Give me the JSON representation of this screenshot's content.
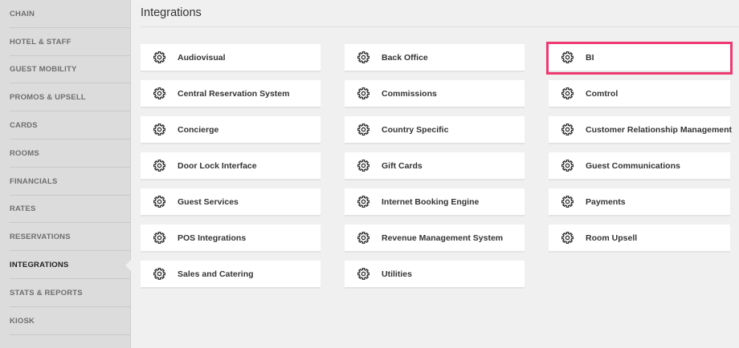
{
  "sidebar": {
    "items": [
      {
        "label": "CHAIN",
        "active": false
      },
      {
        "label": "HOTEL & STAFF",
        "active": false
      },
      {
        "label": "GUEST MOBILITY",
        "active": false
      },
      {
        "label": "PROMOS & UPSELL",
        "active": false
      },
      {
        "label": "CARDS",
        "active": false
      },
      {
        "label": "ROOMS",
        "active": false
      },
      {
        "label": "FINANCIALS",
        "active": false
      },
      {
        "label": "RATES",
        "active": false
      },
      {
        "label": "RESERVATIONS",
        "active": false
      },
      {
        "label": "INTEGRATIONS",
        "active": true
      },
      {
        "label": "STATS & REPORTS",
        "active": false
      },
      {
        "label": "KIOSK",
        "active": false
      }
    ]
  },
  "page": {
    "title": "Integrations"
  },
  "integrations": {
    "icon": "gear-icon",
    "highlight_color": "#ee3a72",
    "items": [
      {
        "label": "Audiovisual"
      },
      {
        "label": "Back Office"
      },
      {
        "label": "BI",
        "highlighted": true
      },
      {
        "label": "Central Reservation System"
      },
      {
        "label": "Commissions"
      },
      {
        "label": "Comtrol"
      },
      {
        "label": "Concierge"
      },
      {
        "label": "Country Specific"
      },
      {
        "label": "Customer Relationship Management"
      },
      {
        "label": "Door Lock Interface"
      },
      {
        "label": "Gift Cards"
      },
      {
        "label": "Guest Communications"
      },
      {
        "label": "Guest Services"
      },
      {
        "label": "Internet Booking Engine"
      },
      {
        "label": "Payments"
      },
      {
        "label": "POS Integrations"
      },
      {
        "label": "Revenue Management System"
      },
      {
        "label": "Room Upsell"
      },
      {
        "label": "Sales and Catering"
      },
      {
        "label": "Utilities"
      }
    ]
  }
}
